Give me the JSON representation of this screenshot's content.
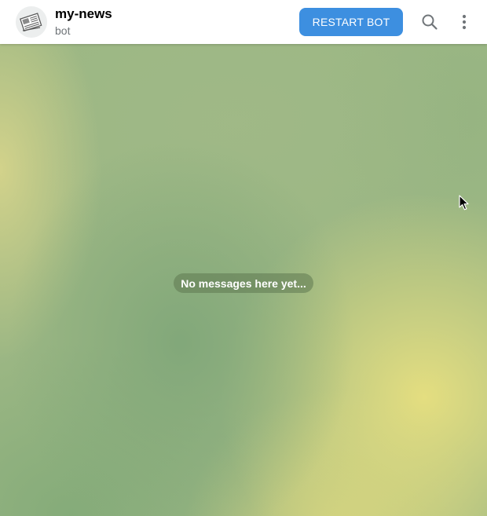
{
  "header": {
    "title": "my-news",
    "subtitle": "bot",
    "restart_label": "RESTART BOT"
  },
  "icons": {
    "avatar": "newspaper-avatar-icon",
    "search": "search-icon",
    "more": "more-vertical-icon",
    "cursor": "mouse-pointer-icon"
  },
  "chat": {
    "empty_text": "No messages here yet..."
  },
  "colors": {
    "accent": "#3d8fe0",
    "header_bg": "#ffffff",
    "subtitle": "#707579",
    "chat_bg": "#9cb784"
  }
}
